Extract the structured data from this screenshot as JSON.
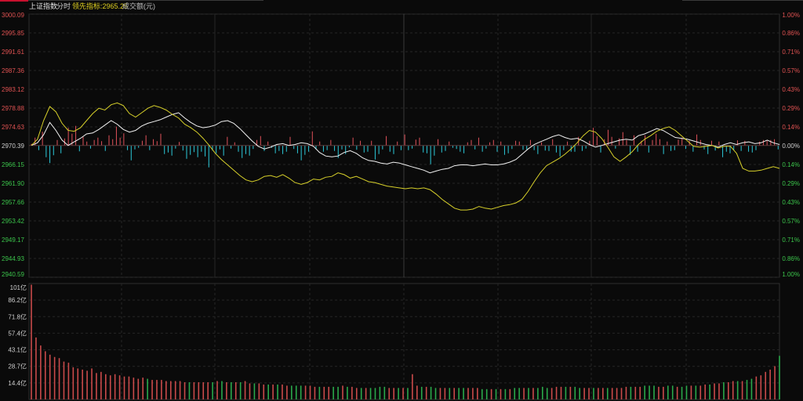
{
  "header": {
    "index_name": "上证指数",
    "mode": "分时",
    "leading_label": "领先指标:2965.25",
    "volume_label": "成交额(元)"
  },
  "colors": {
    "background": "#0a0a0a",
    "up": "#e0515a",
    "down": "#2cc9d9",
    "price_line": "#f2f2f2",
    "leading_line": "#d7d02a",
    "volume_up": "#c94a4a",
    "volume_down": "#2aa84a",
    "axis_red": "#e05252",
    "axis_green": "#3bc44b",
    "axis_neutral": "#cfcfcf"
  },
  "chart_data": [
    {
      "type": "line",
      "title": "",
      "ylim": [
        2940.59,
        3000.09
      ],
      "y_ticks": [
        "3000.09",
        "2995.85",
        "2991.61",
        "2987.36",
        "2983.12",
        "2978.88",
        "2974.63",
        "2970.39",
        "2966.15",
        "2961.90",
        "2957.66",
        "2953.42",
        "2949.17",
        "2944.93",
        "2940.59"
      ],
      "pct_ticks": [
        "1.00%",
        "0.86%",
        "0.71%",
        "0.57%",
        "0.43%",
        "0.29%",
        "0.14%",
        "0.00%",
        "0.14%",
        "0.29%",
        "0.43%",
        "0.57%",
        "0.71%",
        "0.86%",
        "1.00%"
      ],
      "reference": 2970.39,
      "grid": true,
      "series": [
        {
          "name": "上证指数",
          "values": [
            2970.4,
            2971.0,
            2972.8,
            2975.6,
            2973.8,
            2971.6,
            2970.4,
            2971.2,
            2972.0,
            2973.0,
            2973.2,
            2974.0,
            2975.0,
            2976.0,
            2975.2,
            2974.0,
            2973.4,
            2973.8,
            2974.8,
            2975.4,
            2975.8,
            2976.2,
            2976.8,
            2977.4,
            2977.8,
            2976.6,
            2975.6,
            2974.8,
            2974.4,
            2974.6,
            2975.0,
            2975.8,
            2976.0,
            2975.4,
            2974.2,
            2972.8,
            2971.4,
            2970.2,
            2969.6,
            2970.0,
            2970.6,
            2970.8,
            2970.4,
            2970.6,
            2971.0,
            2970.8,
            2970.2,
            2968.8,
            2968.0,
            2967.8,
            2968.0,
            2968.8,
            2969.2,
            2968.6,
            2967.6,
            2967.0,
            2966.8,
            2966.4,
            2966.2,
            2966.6,
            2966.4,
            2966.0,
            2965.6,
            2965.2,
            2964.8,
            2964.2,
            2964.6,
            2965.0,
            2965.2,
            2965.8,
            2966.0,
            2966.0,
            2965.8,
            2966.0,
            2966.2,
            2966.0,
            2966.0,
            2966.2,
            2966.6,
            2967.2,
            2968.4,
            2969.6,
            2970.6,
            2971.2,
            2971.8,
            2972.4,
            2972.8,
            2972.2,
            2971.8,
            2972.0,
            2971.4,
            2970.6,
            2970.0,
            2970.4,
            2970.8,
            2971.2,
            2971.6,
            2971.8,
            2971.6,
            2972.6,
            2973.0,
            2973.6,
            2974.2,
            2973.8,
            2973.0,
            2972.2,
            2972.0,
            2971.8,
            2971.4,
            2971.0,
            2970.6,
            2970.4,
            2970.0,
            2970.6,
            2971.0,
            2970.6,
            2971.0,
            2971.2,
            2970.8,
            2971.0,
            2971.6,
            2971.0,
            2970.6
          ],
          "color": "#f2f2f2"
        },
        {
          "name": "领先指标",
          "values": [
            2970.4,
            2971.8,
            2976.0,
            2979.2,
            2978.0,
            2975.4,
            2973.8,
            2973.6,
            2974.4,
            2976.0,
            2977.6,
            2978.8,
            2978.4,
            2979.6,
            2980.0,
            2979.4,
            2977.6,
            2976.8,
            2977.8,
            2978.8,
            2979.4,
            2979.0,
            2978.4,
            2977.4,
            2976.6,
            2975.2,
            2974.4,
            2973.4,
            2972.0,
            2970.4,
            2968.6,
            2967.2,
            2966.0,
            2964.8,
            2963.6,
            2962.6,
            2962.2,
            2962.6,
            2963.4,
            2963.6,
            2963.2,
            2963.8,
            2963.0,
            2962.0,
            2961.6,
            2962.0,
            2962.8,
            2962.6,
            2963.2,
            2963.4,
            2964.2,
            2963.8,
            2963.0,
            2963.4,
            2962.8,
            2962.2,
            2962.0,
            2961.6,
            2961.2,
            2961.0,
            2960.8,
            2960.6,
            2960.8,
            2960.6,
            2960.8,
            2960.4,
            2959.4,
            2958.2,
            2957.2,
            2956.2,
            2955.8,
            2955.8,
            2956.0,
            2956.6,
            2956.2,
            2956.0,
            2956.4,
            2956.8,
            2957.0,
            2957.4,
            2958.2,
            2960.0,
            2962.2,
            2964.2,
            2965.8,
            2966.6,
            2967.4,
            2968.4,
            2969.6,
            2971.0,
            2972.6,
            2973.8,
            2973.4,
            2972.0,
            2970.0,
            2967.8,
            2966.8,
            2967.8,
            2969.0,
            2970.6,
            2971.8,
            2972.6,
            2973.6,
            2974.2,
            2974.6,
            2973.8,
            2972.6,
            2971.4,
            2970.2,
            2970.0,
            2970.2,
            2970.4,
            2969.8,
            2970.2,
            2970.2,
            2968.6,
            2965.2,
            2964.6,
            2964.6,
            2964.8,
            2965.2,
            2965.6,
            2965.2
          ],
          "color": "#d7d02a"
        }
      ]
    },
    {
      "type": "bar",
      "title": "",
      "ylim": [
        0,
        101
      ],
      "y_ticks": [
        "101亿",
        "86.2亿",
        "71.8亿",
        "57.4亿",
        "43.1亿",
        "28.7亿",
        "14.4亿"
      ],
      "grid": true,
      "series": [
        {
          "name": "成交额",
          "values": [
            100,
            54,
            47,
            42,
            39,
            37,
            36,
            33,
            32,
            28,
            27,
            26,
            25,
            27,
            23,
            24,
            22,
            21,
            22,
            21,
            20,
            20,
            19,
            18,
            19,
            18,
            17,
            17,
            17,
            16,
            16,
            16,
            16,
            15,
            15,
            15,
            15,
            15,
            15,
            15,
            16,
            16,
            15,
            15,
            15,
            15,
            16,
            14,
            14,
            14,
            13,
            13,
            13,
            13,
            13,
            12,
            12,
            12,
            12,
            12,
            12,
            11,
            11,
            11,
            11,
            11,
            11,
            12,
            11,
            11,
            10,
            10,
            10,
            10,
            10,
            11,
            11,
            10,
            10,
            10,
            10,
            10,
            22,
            12,
            11,
            11,
            11,
            10,
            10,
            10,
            10,
            10,
            10,
            10,
            10,
            10,
            10,
            9,
            9,
            9,
            9,
            9,
            9,
            9,
            10,
            10,
            10,
            10,
            10,
            10,
            11,
            10,
            10,
            11,
            11,
            11,
            11,
            11,
            10,
            10,
            10,
            10,
            10,
            10,
            10,
            10,
            10,
            10,
            11,
            11,
            11,
            11,
            12,
            12,
            12,
            11,
            11,
            12,
            12,
            11,
            11,
            12,
            12,
            12,
            12,
            13,
            13,
            14,
            14,
            15,
            15,
            16,
            16,
            16,
            17,
            18,
            20,
            21,
            24,
            26,
            29,
            38
          ],
          "up": [
            1,
            1,
            1,
            1,
            1,
            1,
            1,
            1,
            1,
            1,
            1,
            1,
            1,
            1,
            1,
            1,
            1,
            1,
            1,
            1,
            1,
            1,
            1,
            1,
            1,
            0,
            1,
            1,
            1,
            1,
            1,
            1,
            1,
            1,
            0,
            1,
            1,
            1,
            1,
            0,
            1,
            0,
            1,
            0,
            1,
            0,
            1,
            1,
            0,
            1,
            1,
            0,
            1,
            0,
            1,
            1,
            0,
            0,
            0,
            1,
            1,
            1,
            0,
            1,
            1,
            0,
            0,
            1,
            0,
            1,
            1,
            0,
            1,
            0,
            0,
            0,
            0,
            1,
            1,
            0,
            1,
            0,
            1,
            1,
            0,
            1,
            0,
            0,
            1,
            1,
            0,
            1,
            0,
            0,
            1,
            1,
            1,
            0,
            0,
            1,
            0,
            1,
            0,
            1,
            0,
            0,
            1,
            0,
            1,
            0,
            0,
            0,
            1,
            1,
            1,
            0,
            1,
            0,
            0,
            1,
            1,
            0,
            1,
            1,
            0,
            1,
            1,
            1,
            1,
            0,
            1,
            1,
            0,
            0,
            0,
            1,
            1,
            0,
            0,
            1,
            0,
            0,
            1,
            0,
            1,
            1,
            0,
            1,
            1,
            0,
            1,
            1,
            0,
            1,
            0,
            0,
            1,
            1,
            1,
            1,
            1,
            0
          ]
        }
      ]
    }
  ],
  "tick_bars": {
    "values": [
      0.4,
      2.0,
      -1.2,
      3.5,
      -3.0,
      -4.5,
      -2.5,
      1.4,
      -2.0,
      1.8,
      4.5,
      3.0,
      5.0,
      -1.5,
      2.2,
      1.0,
      -0.8,
      1.4,
      2.0,
      1.1,
      -1.4,
      2.6,
      1.6,
      4.8,
      2.0,
      3.1,
      -1.2,
      -3.8,
      -1.0,
      -0.6,
      1.2,
      2.6,
      -1.2,
      1.6,
      1.1,
      3.0,
      -2.2,
      -1.8,
      -2.6,
      -0.8,
      0.9,
      -1.3,
      -3.4,
      -2.4,
      -1.7,
      -3.0,
      -1.6,
      -2.8,
      -5.6,
      -1.3,
      -2.0,
      -1.0,
      -2.6,
      2.2,
      -0.8,
      0.8,
      -1.6,
      -3.2,
      -2.2,
      -2.6,
      -0.9,
      1.4,
      2.4,
      -1.4,
      1.0,
      -0.6,
      -2.0,
      -1.4,
      -2.2,
      -1.6,
      2.2,
      -0.9,
      -2.0,
      -3.8,
      -2.4,
      -1.6,
      3.6,
      -1.0,
      1.0,
      -1.6,
      -1.2,
      1.4,
      -1.4,
      -3.2,
      -1.0,
      -2.2,
      -0.5,
      2.0,
      -1.1,
      1.2,
      -1.8,
      -1.6,
      1.2,
      -3.6,
      -2.2,
      -1.0,
      2.4,
      -1.6,
      -2.2,
      1.0,
      -1.2,
      2.8,
      -1.2,
      -0.8,
      1.5,
      2.0,
      -1.8,
      -2.0,
      -4.8,
      -2.6,
      1.6,
      -1.8,
      -1.4,
      1.0,
      -0.6,
      -0.9,
      -1.6,
      -2.0,
      0.8,
      1.4,
      -1.0,
      2.0,
      -1.6,
      -0.8,
      0.8,
      1.4,
      -1.6,
      1.0,
      -2.4,
      -2.0,
      -0.9,
      1.2,
      1.0,
      -1.1,
      -1.0,
      1.4,
      -1.2,
      -2.2,
      0.8,
      -1.3,
      -1.4,
      1.6,
      -1.8,
      -2.8,
      -1.2,
      1.0,
      -1.6,
      -1.6,
      2.2,
      -1.4,
      -0.8,
      1.2,
      4.5,
      2.4,
      -1.8,
      1.6,
      4.0,
      2.2,
      -0.8,
      1.8,
      3.4,
      1.4,
      -2.4,
      2.6,
      -1.6,
      1.2,
      2.6,
      -1.8,
      1.4,
      3.0,
      1.6,
      -2.2,
      1.0,
      -1.4,
      -1.2,
      1.5,
      2.0,
      -0.9,
      1.2,
      -1.6,
      2.8,
      1.4,
      -1.0,
      -2.2,
      1.2,
      -1.3,
      1.0,
      -3.0,
      -1.6,
      -2.0,
      -1.2,
      1.3,
      -1.4,
      1.2,
      -1.6,
      -1.8,
      -1.2,
      1.0,
      1.4,
      1.2,
      1.4,
      1.6,
      -1.0
    ]
  }
}
